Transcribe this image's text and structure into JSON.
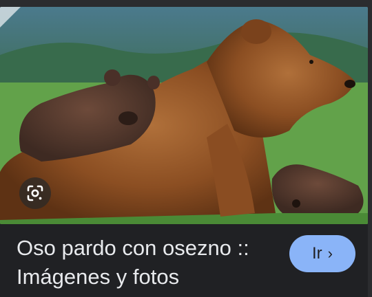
{
  "result": {
    "title_line_1": "Oso pardo con osezno ::",
    "title_line_2": "Imágenes y fotos",
    "go_label": "Ir",
    "go_chevron": "›"
  },
  "image": {
    "subject": "brown-bear-with-cubs-photo"
  },
  "icons": {
    "lens": "google-lens-icon"
  },
  "colors": {
    "background": "#202124",
    "title_text": "#e8eaed",
    "go_button": "#8ab4f8",
    "go_button_text": "#202124"
  }
}
